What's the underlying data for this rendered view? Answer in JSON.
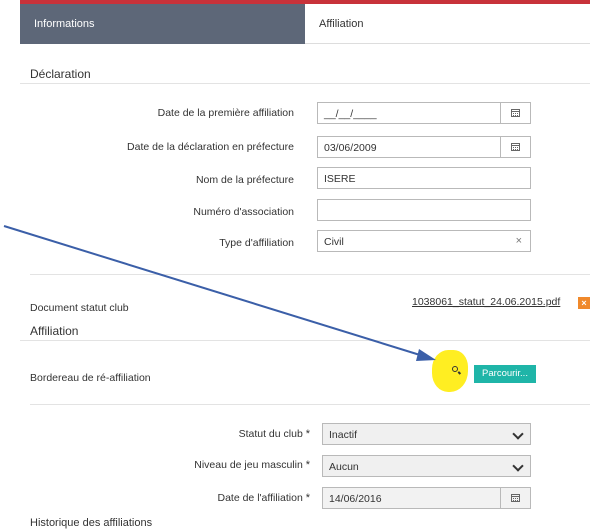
{
  "tabs": [
    {
      "label": "Informations",
      "active": false
    },
    {
      "label": "Affiliation",
      "active": true
    }
  ],
  "declaration": {
    "title": "Déclaration",
    "fields": [
      {
        "label": "Date de la première affiliation",
        "value": "__/__/____",
        "icon": "calendar-icon"
      },
      {
        "label": "Date de la déclaration en préfecture",
        "value": "03/06/2009",
        "icon": "calendar-icon"
      },
      {
        "label": "Nom de la préfecture",
        "value": "ISERE"
      },
      {
        "label": "Numéro d'association",
        "value": ""
      },
      {
        "label": "Type d'affiliation",
        "value": "Civil",
        "clear": "×"
      }
    ]
  },
  "document": {
    "label": "Document statut club",
    "file": "1038061_statut_24.06.2015.pdf",
    "remove": "×"
  },
  "affiliation": {
    "title": "Affiliation",
    "bordereau_label": "Bordereau de ré-affiliation",
    "browse_label": "Parcourir...",
    "statut": {
      "label": "Statut du club",
      "required": "*",
      "value": "Inactif"
    },
    "niveau": {
      "label": "Niveau de jeu masculin",
      "required": "*",
      "value": "Aucun"
    },
    "date": {
      "label": "Date de l'affiliation",
      "required": "*",
      "value": "14/06/2016"
    }
  },
  "historique_title": "Historique des affiliations",
  "colors": {
    "accent": "#c8323a",
    "tab_dark": "#5d6778",
    "browse": "#1fb5a8",
    "remove": "#f0892b",
    "highlight": "#ffee22",
    "arrow": "#3b5fa8"
  }
}
